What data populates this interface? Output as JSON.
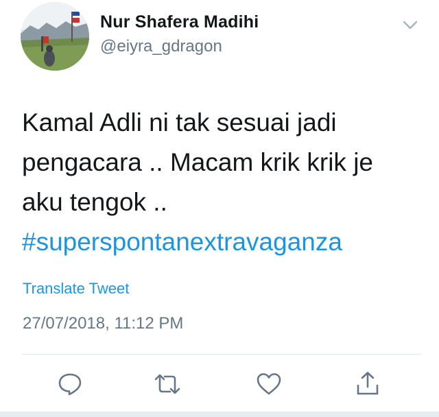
{
  "user": {
    "display_name": "Nur Shafera Madihi",
    "handle": "@eiyra_gdragon",
    "avatar_icon": "profile-photo"
  },
  "tweet": {
    "lines": [
      "Kamal Adli ni tak sesuai jadi",
      "pengacara .. Macam krik krik je",
      "aku tengok .."
    ],
    "hashtag": "#superspontanextravaganza",
    "translate_label": "Translate Tweet",
    "timestamp": "27/07/2018, 11:12 PM"
  },
  "actions": [
    {
      "name": "reply-icon"
    },
    {
      "name": "retweet-icon"
    },
    {
      "name": "like-icon"
    },
    {
      "name": "share-icon"
    }
  ],
  "colors": {
    "link": "#1b95e0",
    "secondary_text": "#657786",
    "icon": "#657786",
    "divider": "#e1e8ed"
  }
}
